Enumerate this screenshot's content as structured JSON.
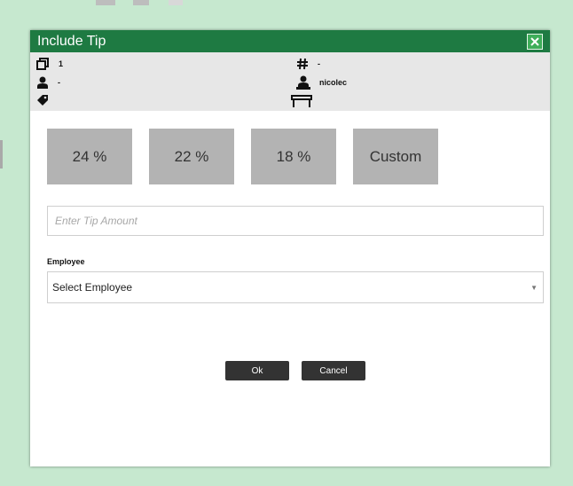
{
  "dialog": {
    "title": "Include Tip",
    "close_icon": "close-icon",
    "accent_color": "#1e7a42"
  },
  "info": {
    "copies_value": "1",
    "order_number_value": "-",
    "customer_value": "-",
    "server_value": "nicolec",
    "tag_value": ""
  },
  "tips": {
    "options": [
      "24 %",
      "22 %",
      "18 %"
    ],
    "custom_label": "Custom"
  },
  "tip_amount": {
    "placeholder": "Enter Tip Amount",
    "value": ""
  },
  "employee": {
    "label": "Employee",
    "selected": "Select Employee"
  },
  "actions": {
    "ok_label": "Ok",
    "cancel_label": "Cancel"
  }
}
